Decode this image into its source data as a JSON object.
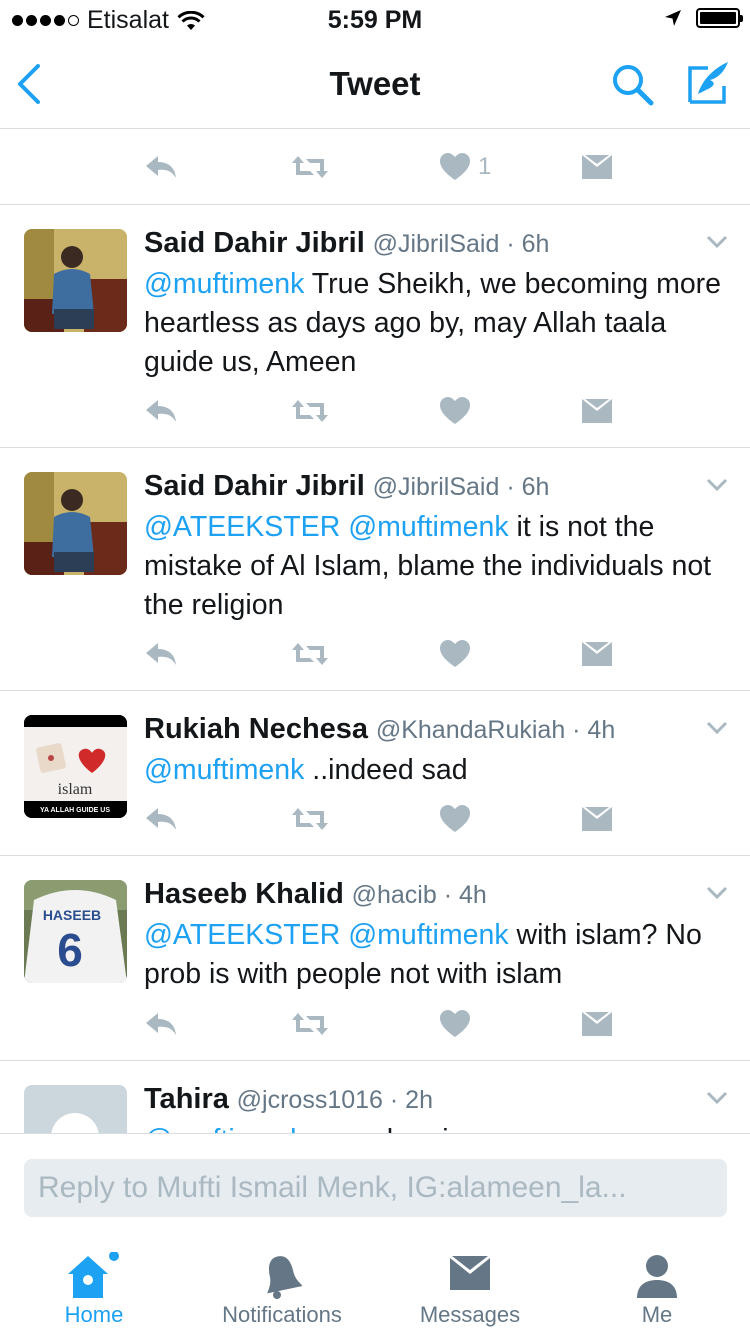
{
  "status_bar": {
    "carrier": "Etisalat",
    "time": "5:59 PM"
  },
  "nav": {
    "title": "Tweet"
  },
  "colors": {
    "accent": "#1da1f2",
    "icon_grey": "#aab8c2",
    "divider": "#d8dde1"
  },
  "top_partial_tweet": {
    "like_count": "1"
  },
  "tweets": [
    {
      "name": "Said Dahir Jibril",
      "handle": "@JibrilSaid · 6h",
      "mentions": "@muftimenk",
      "body": " True Sheikh, we becoming more heartless as days ago by, may Allah taala guide us, Ameen"
    },
    {
      "name": "Said Dahir Jibril",
      "handle": "@JibrilSaid · 6h",
      "mentions": "@ATEEKSTER @muftimenk",
      "body": " it is not the mistake of Al Islam, blame the individuals not the religion"
    },
    {
      "name": "Rukiah Nechesa",
      "handle": "@KhandaRukiah · 4h",
      "mentions": "@muftimenk",
      "body": " ..indeed sad",
      "avatar_text": "islam",
      "avatar_caption": "YA ALLAH GUIDE US"
    },
    {
      "name": "Haseeb Khalid",
      "handle": "@hacib · 4h",
      "mentions": "@ATEEKSTER @muftimenk",
      "body": " with islam? No prob is with people not with islam",
      "avatar_text": "HASEEB",
      "avatar_number": "6"
    },
    {
      "name": "Tahira",
      "handle": "@jcross1016 · 2h",
      "mentions": "@muftimenk",
      "body": " can when i go on"
    }
  ],
  "reply": {
    "placeholder": "Reply to Mufti Ismail Menk, IG:alameen_la..."
  },
  "tabs": [
    {
      "label": "Home",
      "icon": "home-icon",
      "active": true
    },
    {
      "label": "Notifications",
      "icon": "bell-icon"
    },
    {
      "label": "Messages",
      "icon": "envelope-icon"
    },
    {
      "label": "Me",
      "icon": "person-icon"
    }
  ]
}
